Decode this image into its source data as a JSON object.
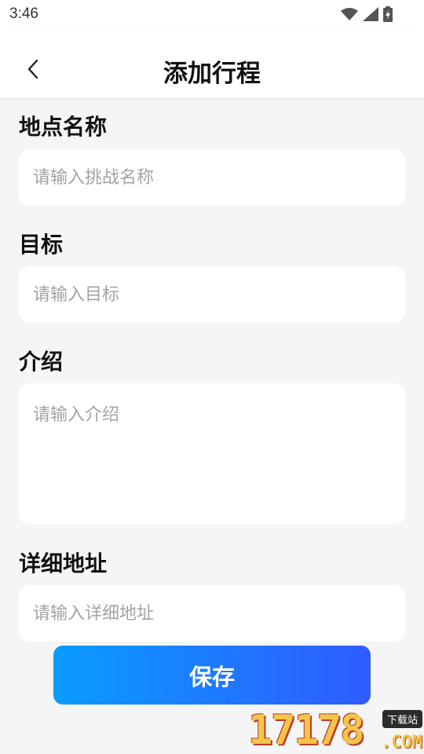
{
  "status_bar": {
    "time": "3:46",
    "icons": [
      "wifi-icon",
      "signal-icon",
      "battery-charging-icon"
    ]
  },
  "header": {
    "title": "添加行程",
    "back_icon": "chevron-left-icon"
  },
  "form": {
    "location_name": {
      "label": "地点名称",
      "placeholder": "请输入挑战名称",
      "value": ""
    },
    "target": {
      "label": "目标",
      "placeholder": "请输入目标",
      "value": ""
    },
    "introduction": {
      "label": "介绍",
      "placeholder": "请输入介绍",
      "value": ""
    },
    "address": {
      "label": "详细地址",
      "placeholder": "请输入详细地址",
      "value": ""
    }
  },
  "save_button": {
    "label": "保存"
  },
  "watermark": {
    "digits": "17178",
    "tag": "下载站",
    "domain": ".COM"
  },
  "colors": {
    "accent_start": "#0a9cff",
    "accent_end": "#2f5bff",
    "background": "#f5f5f5"
  }
}
